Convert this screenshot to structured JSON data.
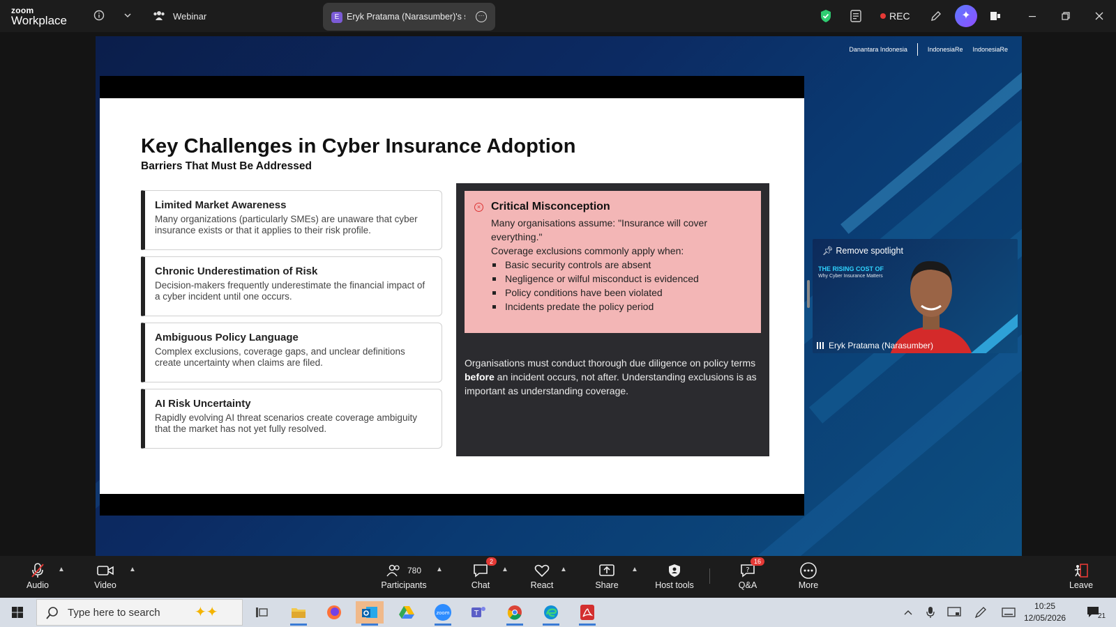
{
  "topbar": {
    "logo_small": "zoom",
    "logo_big": "Workplace",
    "webinar_label": "Webinar",
    "share_tab_initial": "E",
    "share_tab_title": "Eryk Pratama (Narasumber)'s scre",
    "rec_label": "REC"
  },
  "slide": {
    "title": "Key Challenges in Cyber Insurance Adoption",
    "subtitle": "Barriers That Must Be Addressed",
    "cards": [
      {
        "heading": "Limited Market Awareness",
        "body": "Many organizations (particularly SMEs) are unaware that cyber insurance exists or that it applies to their risk profile."
      },
      {
        "heading": "Chronic Underestimation of Risk",
        "body": "Decision-makers frequently underestimate the financial impact of a cyber incident until one occurs."
      },
      {
        "heading": "Ambiguous Policy Language",
        "body": "Complex exclusions, coverage gaps, and unclear definitions create uncertainty when claims are filed."
      },
      {
        "heading": "AI Risk Uncertainty",
        "body": "Rapidly evolving AI threat scenarios create coverage ambiguity that the market has not yet fully resolved."
      }
    ],
    "misconception": {
      "heading": "Critical Misconception",
      "line1": "Many organisations assume: \"Insurance will cover everything.\"",
      "line2": "Coverage exclusions commonly apply when:",
      "bullets": [
        "Basic security controls are absent",
        "Negligence or wilful misconduct is evidenced",
        "Policy conditions have been violated",
        "Incidents predate the policy period"
      ]
    },
    "note": {
      "part1": "Organisations must conduct thorough due diligence on policy terms ",
      "bold": "before",
      "part2": " an incident occurs, not after. Understanding exclusions is as important as understanding coverage."
    },
    "sponsors": [
      "Danantara Indonesia",
      "IndonesiaRe",
      "IndonesiaRe"
    ]
  },
  "video": {
    "spotlight_label": "Remove spotlight",
    "slide_line1": "THE RISING COST OF",
    "slide_line2": "Why Cyber Insurance Matters",
    "name": "Eryk Pratama (Narasumber)"
  },
  "toolbar": {
    "audio": "Audio",
    "video": "Video",
    "participants": "Participants",
    "participants_count": "780",
    "chat": "Chat",
    "chat_badge": "2",
    "react": "React",
    "share": "Share",
    "host_tools": "Host tools",
    "qa": "Q&A",
    "qa_badge": "16",
    "more": "More",
    "leave": "Leave"
  },
  "taskbar": {
    "search_placeholder": "Type here to search",
    "time": "10:25",
    "date": "12/05/2026",
    "notif_count": "21"
  },
  "colors": {
    "accent_blue": "#3a7bd5",
    "rec_red": "#e53935",
    "misconception_pink": "#f3b6b6",
    "dark_panel": "#2b2b2f"
  }
}
